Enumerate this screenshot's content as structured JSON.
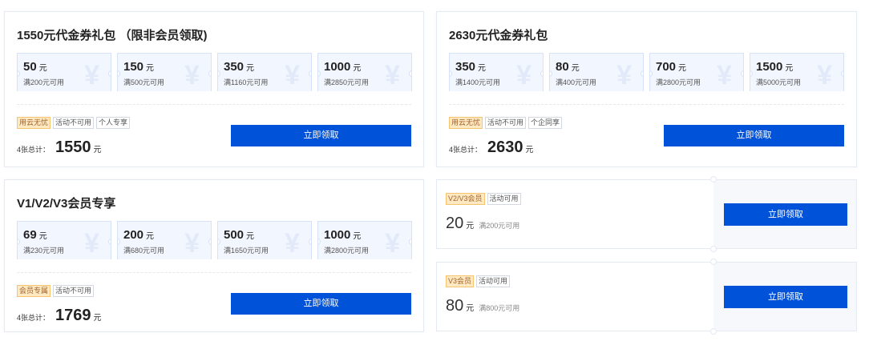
{
  "packages": [
    {
      "title": "1550元代金券礼包 （限非会员领取)",
      "coupons": [
        {
          "amount": "50",
          "unit": "元",
          "condition": "满200元可用"
        },
        {
          "amount": "150",
          "unit": "元",
          "condition": "满500元可用"
        },
        {
          "amount": "350",
          "unit": "元",
          "condition": "满1160元可用"
        },
        {
          "amount": "1000",
          "unit": "元",
          "condition": "满2850元可用"
        }
      ],
      "tags": [
        "用云无忧",
        "活动不可用",
        "个人专享"
      ],
      "total_label": "4张总计：",
      "total": "1550",
      "total_unit": "元",
      "button": "立即领取"
    },
    {
      "title": "2630元代金券礼包",
      "coupons": [
        {
          "amount": "350",
          "unit": "元",
          "condition": "满1400元可用"
        },
        {
          "amount": "80",
          "unit": "元",
          "condition": "满400元可用"
        },
        {
          "amount": "700",
          "unit": "元",
          "condition": "满2800元可用"
        },
        {
          "amount": "1500",
          "unit": "元",
          "condition": "满5000元可用"
        }
      ],
      "tags": [
        "用云无忧",
        "活动不可用",
        "个企同享"
      ],
      "total_label": "4张总计：",
      "total": "2630",
      "total_unit": "元",
      "button": "立即领取"
    },
    {
      "title": "V1/V2/V3会员专享",
      "coupons": [
        {
          "amount": "69",
          "unit": "元",
          "condition": "满230元可用"
        },
        {
          "amount": "200",
          "unit": "元",
          "condition": "满680元可用"
        },
        {
          "amount": "500",
          "unit": "元",
          "condition": "满1650元可用"
        },
        {
          "amount": "1000",
          "unit": "元",
          "condition": "满2800元可用"
        }
      ],
      "tags": [
        "会员专属",
        "活动不可用"
      ],
      "total_label": "4张总计：",
      "total": "1769",
      "total_unit": "元",
      "button": "立即领取"
    }
  ],
  "single_coupons": [
    {
      "tags": [
        "V2/V3会员",
        "活动可用"
      ],
      "amount": "20",
      "unit": "元",
      "condition": "满200元可用",
      "button": "立即领取"
    },
    {
      "tags": [
        "V3会员",
        "活动可用"
      ],
      "amount": "80",
      "unit": "元",
      "condition": "满800元可用",
      "button": "立即领取"
    }
  ],
  "icons": {
    "coupon_watermark": "yen-icon"
  },
  "colors": {
    "primary": "#0052d9",
    "gold_tag": "#ffe9c2"
  }
}
